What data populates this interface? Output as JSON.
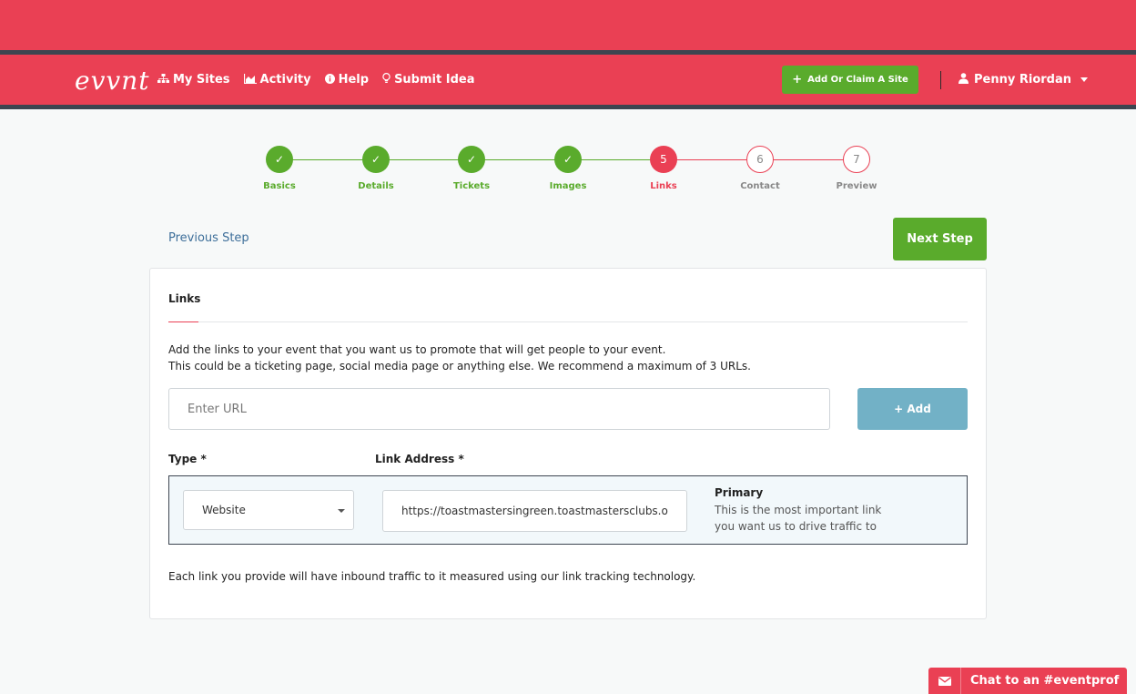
{
  "header": {
    "logo": "evvnt",
    "nav": [
      {
        "label": "My Sites",
        "icon": "sitemap-icon"
      },
      {
        "label": "Activity",
        "icon": "area-chart-icon"
      },
      {
        "label": "Help",
        "icon": "info-circle-icon"
      },
      {
        "label": "Submit Idea",
        "icon": "lightbulb-icon"
      }
    ],
    "add_site_label": "Add Or Claim A Site",
    "user_name": "Penny Riordan"
  },
  "stepper": {
    "steps": [
      {
        "number": "✓",
        "label": "Basics",
        "state": "done"
      },
      {
        "number": "✓",
        "label": "Details",
        "state": "done"
      },
      {
        "number": "✓",
        "label": "Tickets",
        "state": "done"
      },
      {
        "number": "✓",
        "label": "Images",
        "state": "done"
      },
      {
        "number": "5",
        "label": "Links",
        "state": "current"
      },
      {
        "number": "6",
        "label": "Contact",
        "state": "todo"
      },
      {
        "number": "7",
        "label": "Preview",
        "state": "todo"
      }
    ]
  },
  "actions": {
    "previous_label": "Previous Step",
    "next_label": "Next Step"
  },
  "card": {
    "title": "Links",
    "description_line1": "Add the links to your event that you want us to promote that will get people to your event.",
    "description_line2": "This could be a ticketing page, social media page or anything else. We recommend a maximum of 3 URLs.",
    "url_placeholder": "Enter URL",
    "add_label": "+ Add",
    "col_type": "Type *",
    "col_link": "Link Address *",
    "link_row": {
      "type_value": "Website",
      "link_value": "https://toastmastersingreen.toastmastersclubs.or",
      "primary_title": "Primary",
      "primary_desc": "This is the most important link you want us to drive traffic to"
    },
    "footnote": "Each link you provide will have inbound traffic to it measured using our link tracking technology."
  },
  "chat": {
    "label": "Chat to an #eventprof"
  },
  "colors": {
    "brand_red": "#ea4054",
    "success_green": "#5aab2c",
    "add_button_blue": "#72b1c6",
    "dark_stripe": "#3d4550"
  }
}
